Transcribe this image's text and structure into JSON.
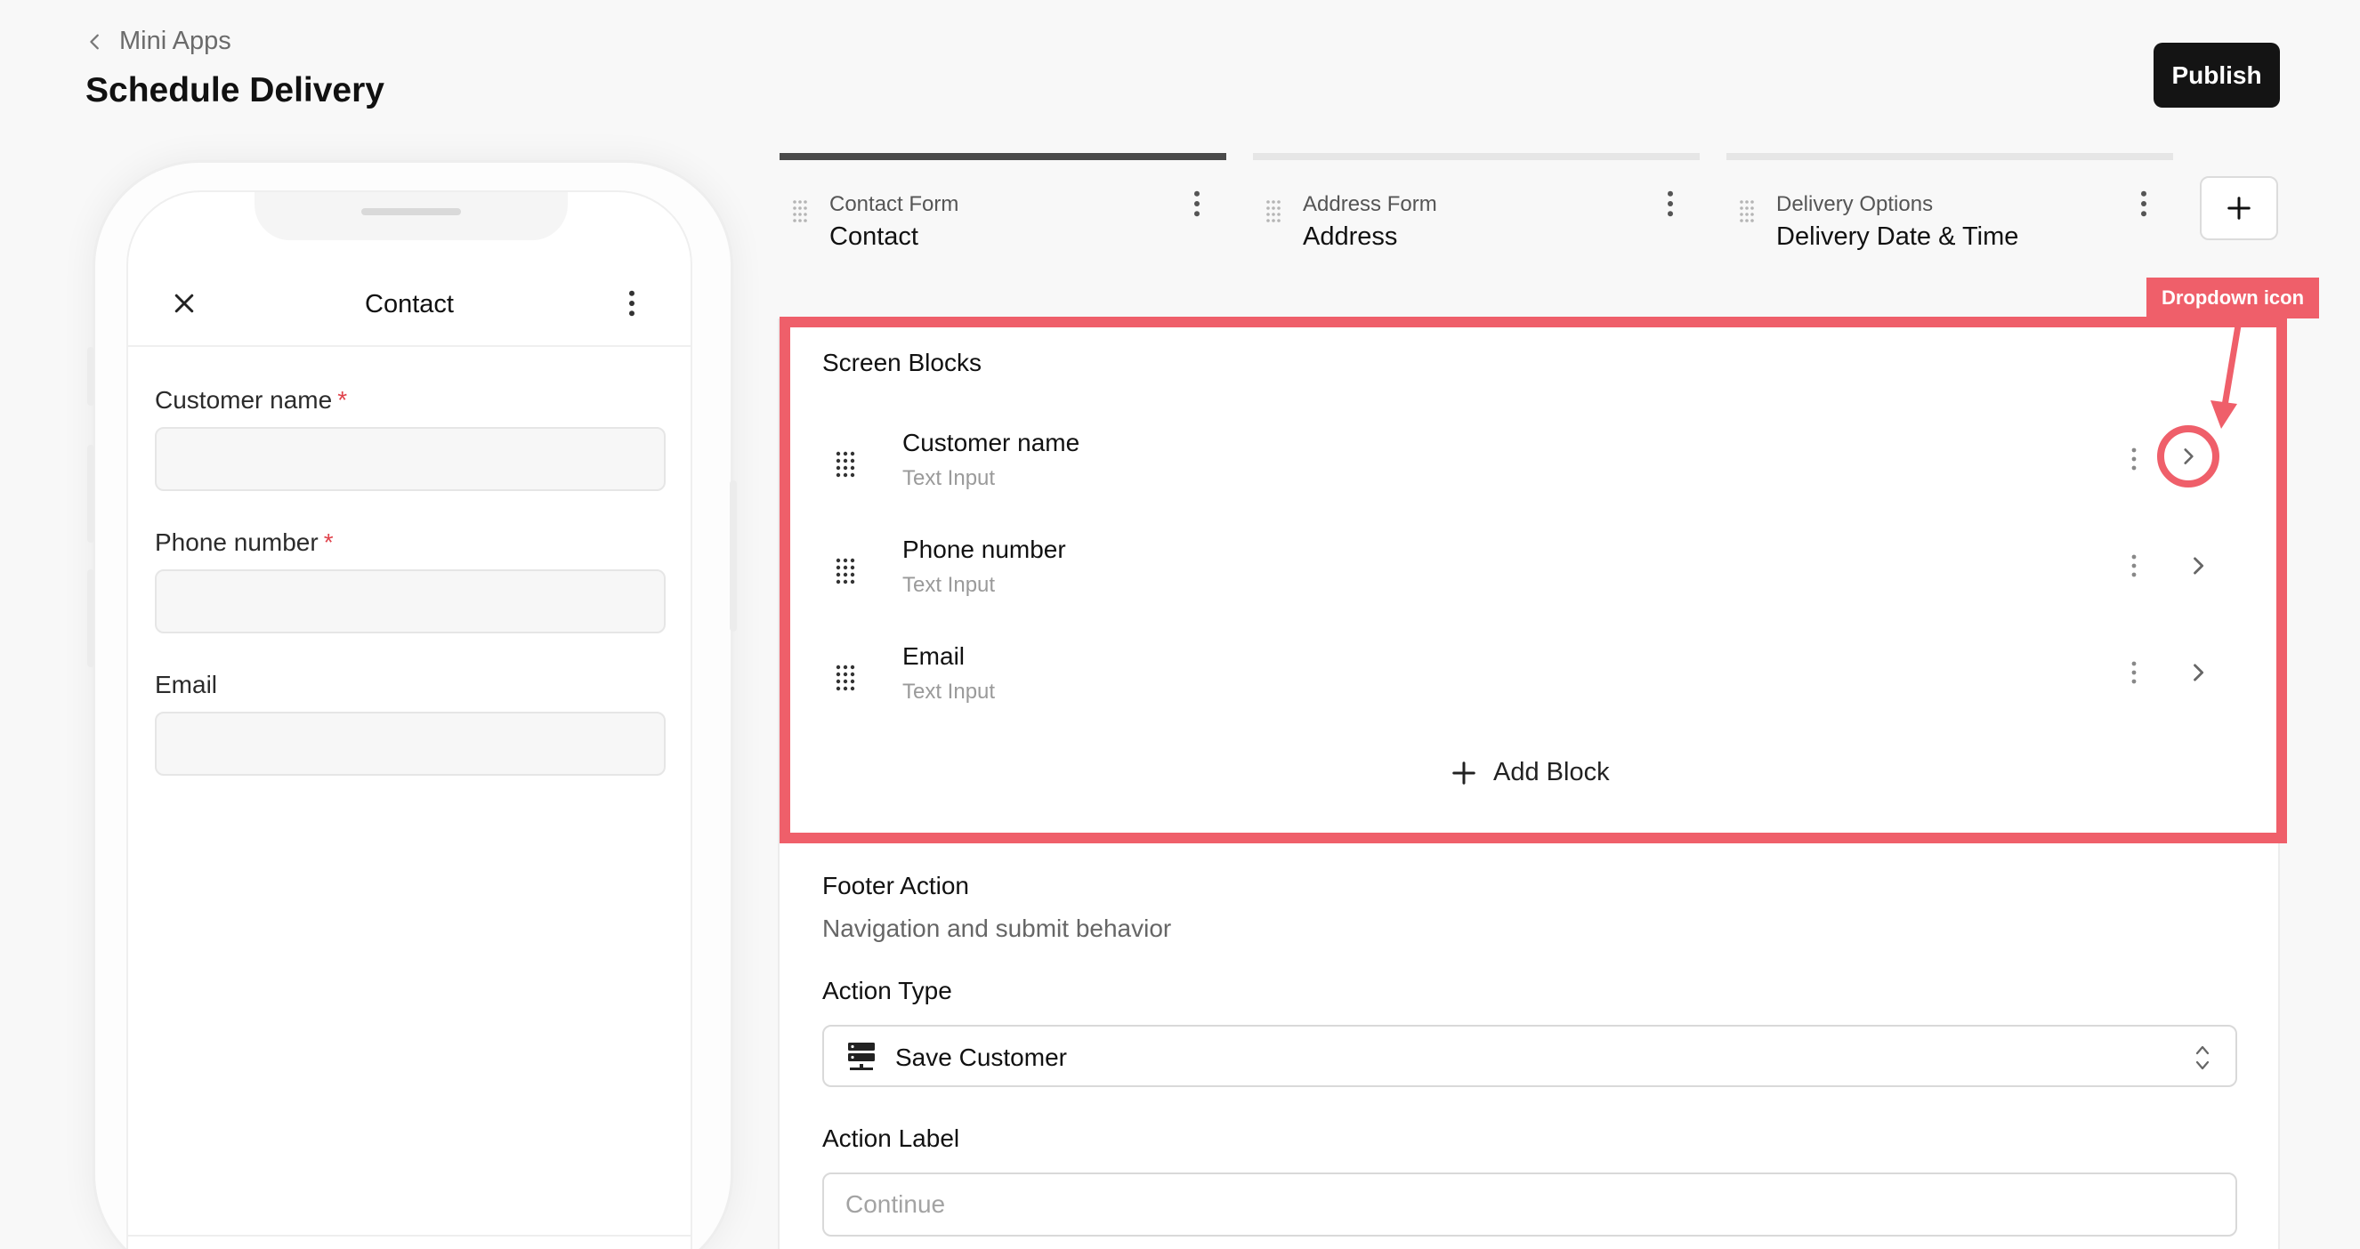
{
  "header": {
    "breadcrumb": "Mini Apps",
    "title": "Schedule Delivery",
    "publish_label": "Publish"
  },
  "phone": {
    "screen_title": "Contact",
    "fields": [
      {
        "label": "Customer name",
        "required_mark": "*"
      },
      {
        "label": "Phone number",
        "required_mark": "*"
      },
      {
        "label": "Email",
        "required_mark": ""
      }
    ]
  },
  "tabs": [
    {
      "sub": "Contact Form",
      "main": "Contact",
      "active": true
    },
    {
      "sub": "Address Form",
      "main": "Address",
      "active": false
    },
    {
      "sub": "Delivery Options",
      "main": "Delivery Date & Time",
      "active": false
    }
  ],
  "screen_blocks": {
    "title": "Screen Blocks",
    "items": [
      {
        "name": "Customer name",
        "type": "Text Input"
      },
      {
        "name": "Phone number",
        "type": "Text Input"
      },
      {
        "name": "Email",
        "type": "Text Input"
      }
    ],
    "add_label": "Add Block"
  },
  "annotation": {
    "label": "Dropdown icon",
    "color": "#ef5f6a"
  },
  "footer_action": {
    "title": "Footer Action",
    "subtitle": "Navigation and submit behavior",
    "action_type_label": "Action Type",
    "action_type_value": "Save Customer",
    "action_label_label": "Action Label",
    "action_label_placeholder": "Continue"
  }
}
